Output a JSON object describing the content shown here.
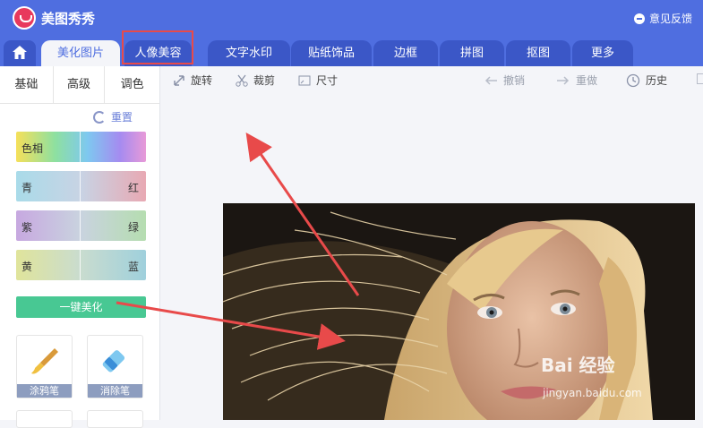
{
  "app": {
    "title": "美图秀秀",
    "feedback": "意见反馈"
  },
  "tabs": [
    {
      "label": "美化图片",
      "active": true
    },
    {
      "label": "人像美容",
      "active": false
    },
    {
      "label": "文字水印",
      "active": false
    },
    {
      "label": "贴纸饰品",
      "active": false
    },
    {
      "label": "边框",
      "active": false
    },
    {
      "label": "拼图",
      "active": false
    },
    {
      "label": "抠图",
      "active": false
    },
    {
      "label": "更多",
      "active": false
    }
  ],
  "subtabs": [
    "基础",
    "高级",
    "调色"
  ],
  "reset_label": "重置",
  "sliders": [
    {
      "left": "色相",
      "right": ""
    },
    {
      "left": "青",
      "right": "红"
    },
    {
      "left": "紫",
      "right": "绿"
    },
    {
      "left": "黄",
      "right": "蓝"
    }
  ],
  "one_key": "一键美化",
  "tools": [
    {
      "label": "涂鸦笔"
    },
    {
      "label": "消除笔"
    }
  ],
  "toolbar": {
    "rotate": "旋转",
    "crop": "裁剪",
    "size": "尺寸",
    "undo": "撤销",
    "redo": "重做",
    "history": "历史"
  },
  "watermark": {
    "main": "Bai 经验",
    "sub": "jingyan.baidu.com"
  },
  "colors": {
    "brand": "#4f6ee0",
    "accent": "#48c893",
    "annotation": "#e84a4a"
  }
}
